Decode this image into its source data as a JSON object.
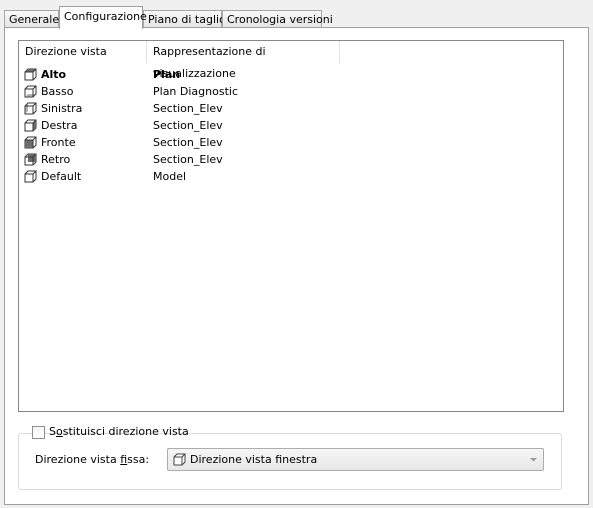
{
  "tabs": [
    {
      "label": "Generale"
    },
    {
      "label": "Configurazione"
    },
    {
      "label": "Piano di taglio"
    },
    {
      "label": "Cronologia versioni"
    }
  ],
  "active_tab": "Configurazione",
  "list": {
    "columns": [
      "Direzione vista",
      "Rappresentazione di visualizzazione"
    ],
    "rows": [
      {
        "name": "Alto",
        "rep": "Plan",
        "icon": "view-top-icon",
        "bold": true
      },
      {
        "name": "Basso",
        "rep": "Plan Diagnostic",
        "icon": "view-bottom-icon"
      },
      {
        "name": "Sinistra",
        "rep": "Section_Elev",
        "icon": "view-left-icon"
      },
      {
        "name": "Destra",
        "rep": "Section_Elev",
        "icon": "view-right-icon"
      },
      {
        "name": "Fronte",
        "rep": "Section_Elev",
        "icon": "view-front-icon"
      },
      {
        "name": "Retro",
        "rep": "Section_Elev",
        "icon": "view-back-icon"
      },
      {
        "name": "Default",
        "rep": "Model",
        "icon": "view-default-icon"
      }
    ]
  },
  "override": {
    "checkbox_label_prefix": "S",
    "checkbox_label_underline": "o",
    "checkbox_label_rest": "stituisci direzione vista",
    "checked": false
  },
  "fixed": {
    "label_prefix": "Direzione vista ",
    "label_underline": "f",
    "label_rest": "issa:",
    "value": "Direzione vista finestra",
    "icon": "view-window-icon"
  }
}
